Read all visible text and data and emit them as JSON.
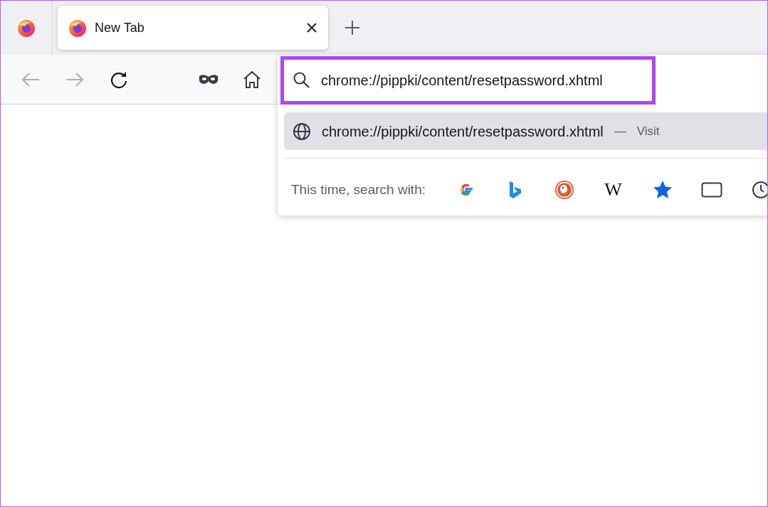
{
  "tabs": [
    {
      "label": "New Tab",
      "selected": true
    }
  ],
  "toolbar": {
    "back_disabled": true,
    "forward_disabled": true
  },
  "urlbar": {
    "value": "chrome://pippki/content/resetpassword.xhtml"
  },
  "suggestions": [
    {
      "url": "chrome://pippki/content/resetpassword.xhtml",
      "separator": "—",
      "action": "Visit",
      "selected": true
    }
  ],
  "search_with": {
    "label": "This time, search with:",
    "engines": [
      {
        "kind": "google"
      },
      {
        "kind": "bing"
      },
      {
        "kind": "duckduckgo"
      },
      {
        "kind": "wikipedia",
        "glyph": "W"
      },
      {
        "kind": "bookmarks"
      },
      {
        "kind": "tabs"
      },
      {
        "kind": "history"
      }
    ]
  }
}
